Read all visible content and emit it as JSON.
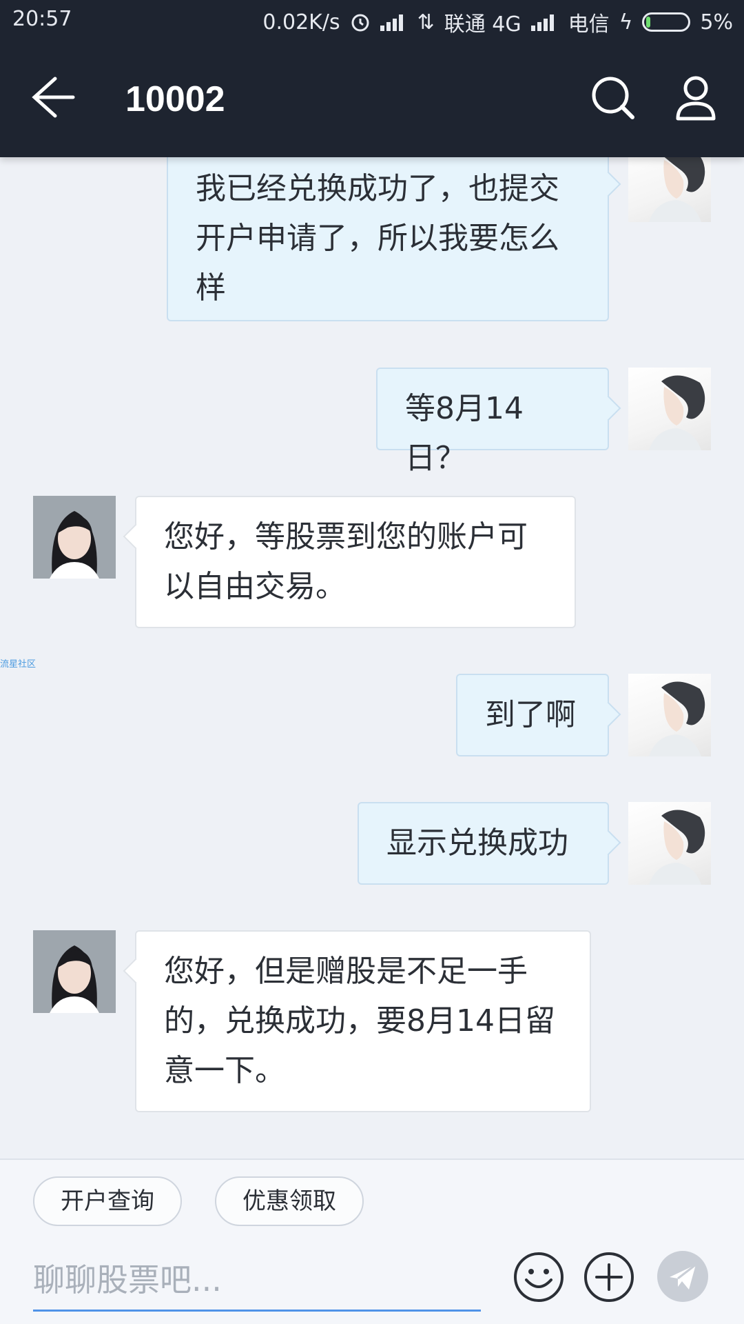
{
  "status_bar": {
    "time": "20:57",
    "speed": "0.02K/s",
    "carrier1": "联通 4G",
    "carrier2": "电信",
    "battery": "5%"
  },
  "header": {
    "title": "10002"
  },
  "messages": [
    {
      "side": "out",
      "text": "我已经兑换成功了，也提交开户申请了，所以我要怎么样"
    },
    {
      "side": "out",
      "text": "等8月14日？"
    },
    {
      "side": "in",
      "text": "您好，等股票到您的账户可以自由交易。"
    },
    {
      "side": "out",
      "text": "到了啊"
    },
    {
      "side": "out",
      "text": "显示兑换成功"
    },
    {
      "side": "in",
      "text": "您好，但是赠股是不足一手的，兑换成功，要8月14日留意一下。"
    }
  ],
  "watermark": "流星社区",
  "quick_actions": [
    "开户查询",
    "优惠领取"
  ],
  "input": {
    "placeholder": "聊聊股票吧..."
  },
  "colors": {
    "header_bg": "#1e2430",
    "outgoing_bubble": "#e6f4fc",
    "incoming_bubble": "#ffffff",
    "input_underline": "#4f93e8"
  },
  "icons": [
    "back-arrow-icon",
    "search-icon",
    "user-icon",
    "emoji-icon",
    "plus-icon",
    "send-icon"
  ]
}
